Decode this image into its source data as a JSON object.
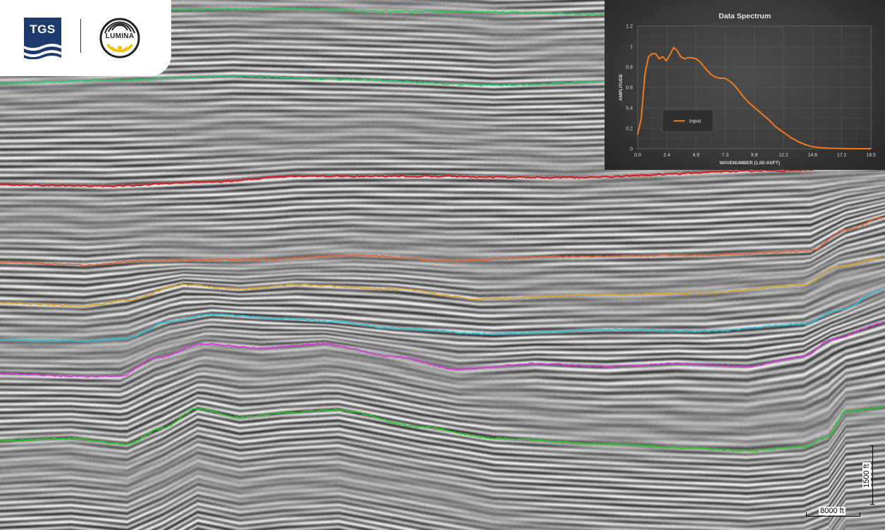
{
  "logos": {
    "company": "TGS",
    "product": "LUMINA"
  },
  "colors": {
    "horizon_1": "#22cc55",
    "horizon_2": "#22cc66",
    "horizon_3": "#d42020",
    "horizon_4": "#e86030",
    "horizon_5": "#e0a020",
    "horizon_6": "#20c0d8",
    "horizon_7": "#e030e0",
    "horizon_8": "#20d020",
    "spectrum_line": "#f07a22",
    "tgs_blue": "#1d3a6e",
    "lumina_yellow": "#f3c200"
  },
  "scale": {
    "horizontal_label": "8000 ft",
    "vertical_label": "1500 ft"
  },
  "chart_data": {
    "type": "line",
    "title": "Data Spectrum",
    "xlabel": "WAVENUMBER (1.0E-03/FT)",
    "ylabel": "AMPLITUDE",
    "xticks": [
      "0.0",
      "2.4",
      "4.9",
      "7.3",
      "9.8",
      "12.2",
      "14.6",
      "17.1",
      "19.5"
    ],
    "yticks": [
      "0",
      "0.2",
      "0.4",
      "0.6",
      "0.8",
      "1",
      "1.2"
    ],
    "xlim": [
      0,
      19.5
    ],
    "ylim": [
      0,
      1.2
    ],
    "grid": true,
    "legend_position": "lower-left",
    "series": [
      {
        "name": "Input",
        "x": [
          0.0,
          0.3,
          0.6,
          0.9,
          1.2,
          1.5,
          1.8,
          2.1,
          2.4,
          2.7,
          3.0,
          3.3,
          3.6,
          3.9,
          4.2,
          4.5,
          4.9,
          5.3,
          5.7,
          6.1,
          6.5,
          6.9,
          7.3,
          7.7,
          8.1,
          8.5,
          8.9,
          9.3,
          9.8,
          10.2,
          10.6,
          11.0,
          11.4,
          11.8,
          12.2,
          12.8,
          13.4,
          14.0,
          14.6,
          15.3,
          16.0,
          17.1,
          18.3,
          19.5
        ],
        "y": [
          0.14,
          0.3,
          0.72,
          0.9,
          0.93,
          0.93,
          0.88,
          0.9,
          0.86,
          0.92,
          0.99,
          0.96,
          0.9,
          0.88,
          0.89,
          0.89,
          0.88,
          0.84,
          0.78,
          0.73,
          0.7,
          0.69,
          0.69,
          0.66,
          0.62,
          0.56,
          0.5,
          0.45,
          0.4,
          0.36,
          0.32,
          0.28,
          0.23,
          0.19,
          0.16,
          0.11,
          0.07,
          0.04,
          0.02,
          0.01,
          0.005,
          0.002,
          0.0,
          0.0
        ]
      }
    ]
  }
}
